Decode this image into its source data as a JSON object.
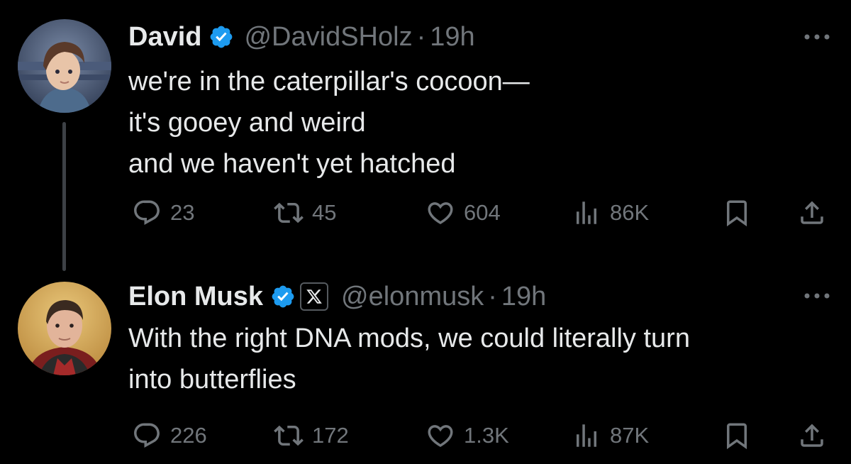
{
  "colors": {
    "background": "#000000",
    "text_primary": "#e7e9ea",
    "text_secondary": "#71767b",
    "verified_blue": "#1d9bf0",
    "thread_line": "#3d4146"
  },
  "tweets": [
    {
      "author": {
        "name": "David",
        "handle": "@DavidSHolz",
        "verified": true,
        "affiliate_badge": null,
        "avatar_icon": "illustrated-portrait-avatar"
      },
      "separator": "·",
      "time": "19h",
      "text_lines": [
        "we're in the caterpillar's cocoon—",
        "it's gooey and weird",
        "and we haven't yet hatched"
      ],
      "metrics": {
        "replies": "23",
        "retweets": "45",
        "likes": "604",
        "views": "86K"
      }
    },
    {
      "author": {
        "name": "Elon Musk",
        "handle": "@elonmusk",
        "verified": true,
        "affiliate_badge": "x-logo-icon",
        "avatar_icon": "photo-portrait-avatar"
      },
      "separator": "·",
      "time": "19h",
      "text_lines": [
        "With the right DNA mods, we could literally turn",
        "into butterflies"
      ],
      "metrics": {
        "replies": "226",
        "retweets": "172",
        "likes": "1.3K",
        "views": "87K"
      }
    }
  ],
  "icons": {
    "more": "more-horizontal-icon",
    "reply": "reply-bubble-icon",
    "retweet": "retweet-icon",
    "like": "heart-icon",
    "views": "views-bar-chart-icon",
    "bookmark": "bookmark-icon",
    "share": "share-upload-icon",
    "verified": "verified-badge-icon"
  }
}
